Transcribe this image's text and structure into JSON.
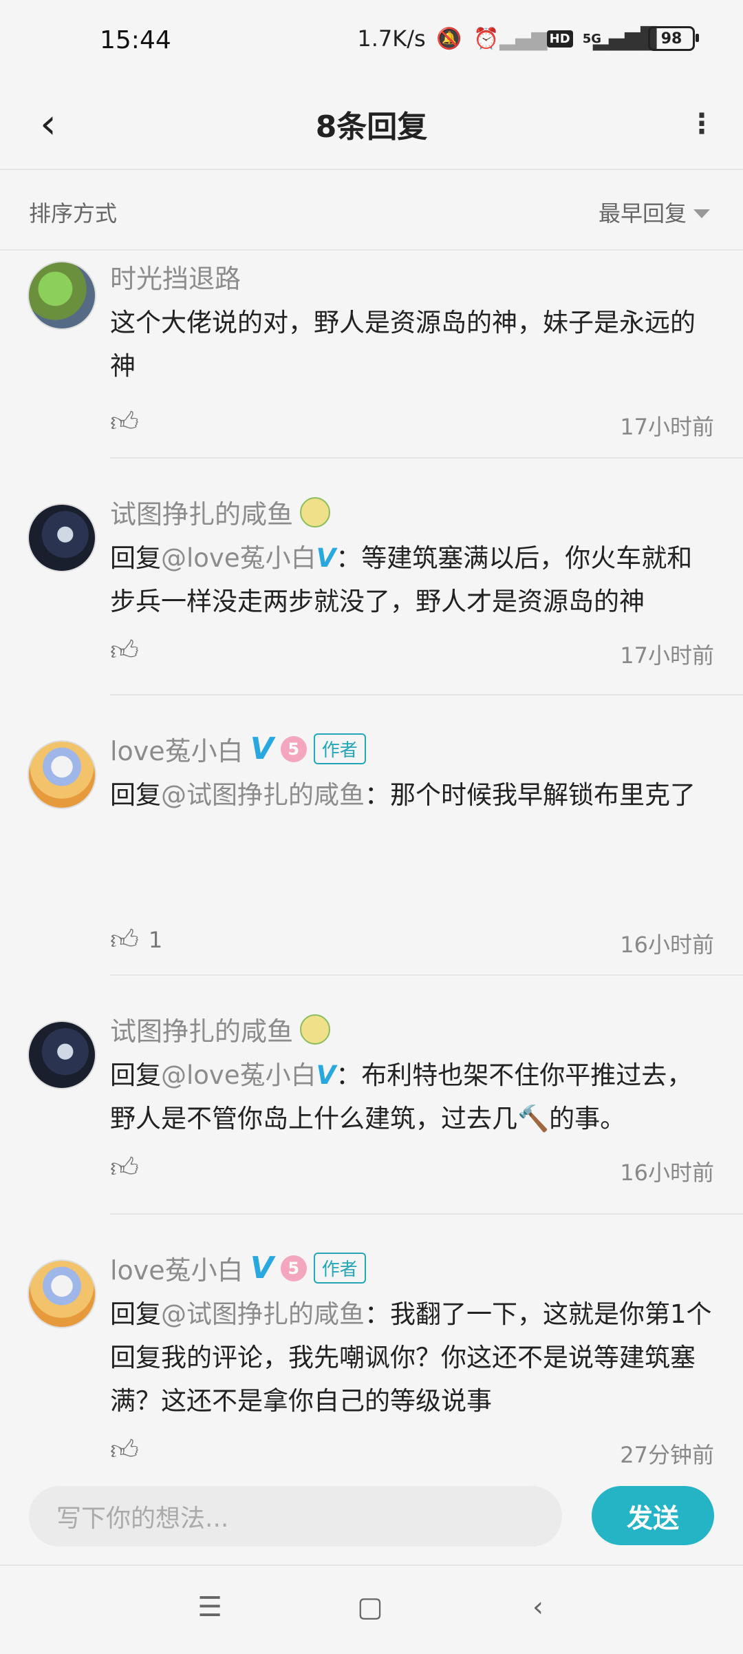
{
  "status": {
    "time": "15:44",
    "speed": "1.7K/s",
    "network": "5G",
    "hd": "HD",
    "battery": "98"
  },
  "nav": {
    "title": "8条回复"
  },
  "sort": {
    "label": "排序方式",
    "value": "最早回复"
  },
  "comments": [
    {
      "username": "时光挡退路",
      "text": "这个大佬说的对，野人是资源岛的神，妹子是永远的神",
      "likes": "",
      "time": "17小时前"
    },
    {
      "username": "试图挣扎的咸鱼",
      "reply_prefix": "回复",
      "reply_to": "@love菟小白",
      "text": "：等建筑塞满以后，你火车就和步兵一样没走两步就没了，野人才是资源岛的神",
      "likes": "",
      "time": "17小时前"
    },
    {
      "username": "love菟小白",
      "level": "5",
      "author_tag": "作者",
      "reply_prefix": "回复",
      "reply_to": "@试图挣扎的咸鱼",
      "text": "：那个时候我早解锁布里克了",
      "likes": "1",
      "time": "16小时前"
    },
    {
      "username": "试图挣扎的咸鱼",
      "reply_prefix": "回复",
      "reply_to": "@love菟小白",
      "text": "：布利特也架不住你平推过去，野人是不管你岛上什么建筑，过去几🔨的事。",
      "likes": "",
      "time": "16小时前"
    },
    {
      "username": "love菟小白",
      "level": "5",
      "author_tag": "作者",
      "reply_prefix": "回复",
      "reply_to": "@试图挣扎的咸鱼",
      "text": "：我翻了一下，这就是你第1个回复我的评论，我先嘲讽你？你这还不是说等建筑塞满？这还不是拿你自己的等级说事",
      "likes": "",
      "time": "27分钟前"
    }
  ],
  "composer": {
    "placeholder": "写下你的想法...",
    "send_label": "发送"
  }
}
